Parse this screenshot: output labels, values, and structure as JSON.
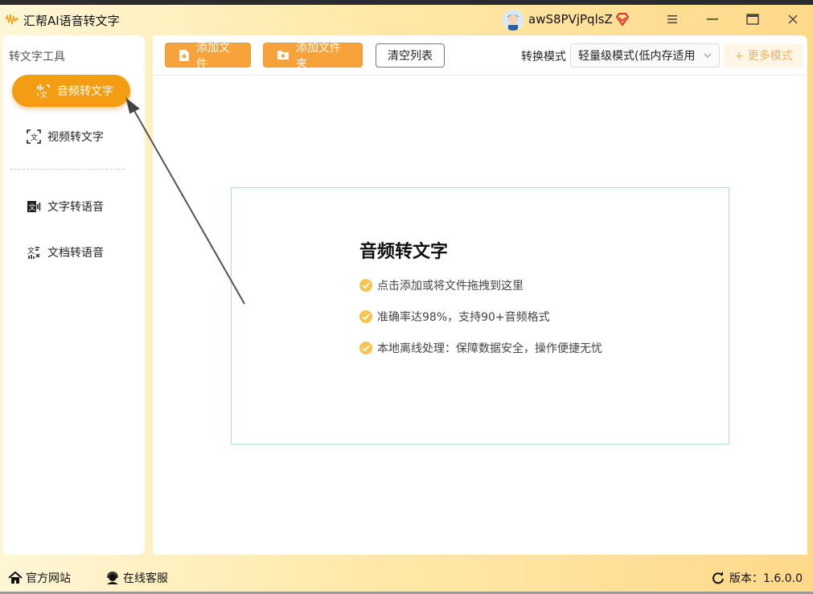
{
  "app": {
    "title": "汇帮AI语音转文字",
    "username": "awS8PVjPqlsZ"
  },
  "sidebar": {
    "heading": "转文字工具",
    "items": [
      {
        "label": "音频转文字",
        "icon": "audio-to-text-icon",
        "active": true
      },
      {
        "label": "视频转文字",
        "icon": "video-to-text-icon",
        "active": false
      },
      {
        "label": "文字转语音",
        "icon": "text-to-speech-icon",
        "active": false
      },
      {
        "label": "文档转语音",
        "icon": "document-to-speech-icon",
        "active": false
      }
    ]
  },
  "toolbar": {
    "add_file": "添加文件",
    "add_folder": "添加文件夹",
    "clear_list": "清空列表",
    "mode_label": "转换模式",
    "mode_value": "轻量级模式(低内存适用",
    "more_modes": "+ 更多模式"
  },
  "dropzone": {
    "title": "音频转文字",
    "features": [
      "点击添加或将文件拖拽到这里",
      "准确率达98%，支持90+音频格式",
      "本地离线处理：保障数据安全，操作便捷无忧"
    ]
  },
  "footer": {
    "website": "官方网站",
    "support": "在线客服",
    "version": "版本：1.6.0.0"
  },
  "colors": {
    "accent": "#f59d12",
    "button": "#f7a23a",
    "check": "#f6c44f",
    "dropzone_border": "#a9e0cf"
  }
}
